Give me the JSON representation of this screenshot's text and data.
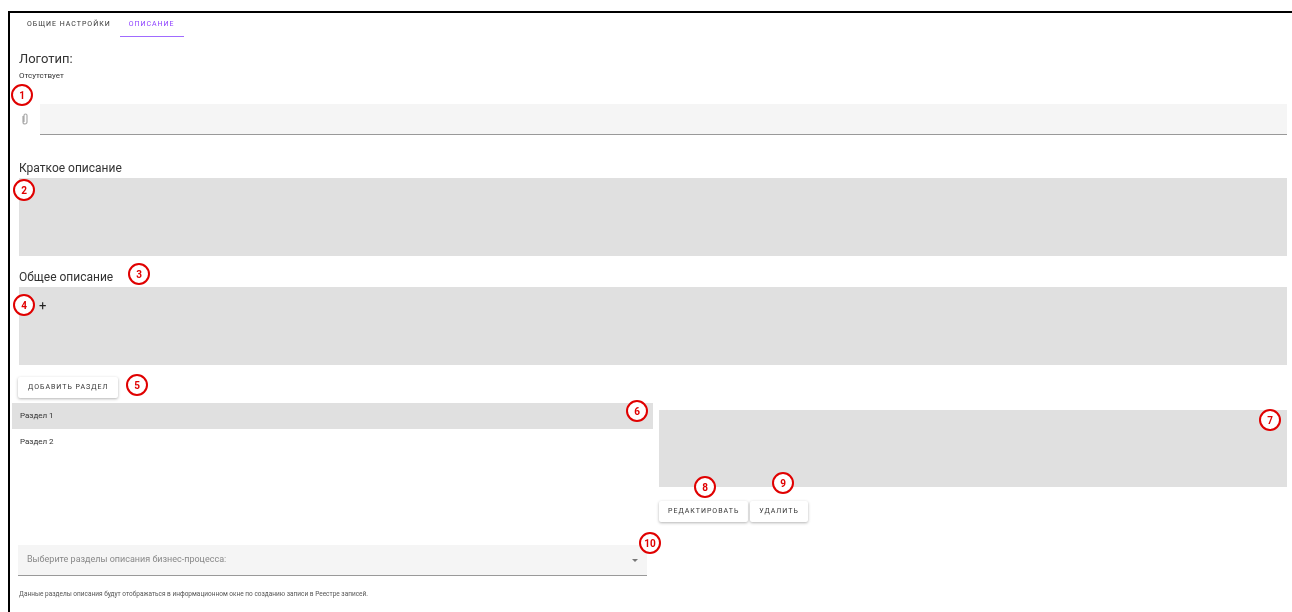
{
  "tabs": [
    {
      "label": "ОБЩИЕ НАСТРОЙКИ",
      "selected": false
    },
    {
      "label": "ОПИСАНИЕ",
      "selected": true
    }
  ],
  "logo": {
    "label": "Логотип:",
    "status": "Отсутствует"
  },
  "short_description": {
    "label": "Краткое описание"
  },
  "general_description": {
    "label": "Общее описание",
    "add_symbol": "+"
  },
  "add_section_button": "ДОБАВИТЬ РАЗДЕЛ",
  "sections": [
    {
      "label": "Раздел 1",
      "selected": true
    },
    {
      "label": "Раздел 2",
      "selected": false
    }
  ],
  "section_buttons": [
    "РЕДАКТИРОВАТЬ",
    "УДАЛИТЬ"
  ],
  "select": {
    "placeholder": "Выберите разделы описания бизнес-процесса:"
  },
  "hint": "Данные разделы описания будут отображаться в информационном окне по созданию записи в Реестре записей.",
  "callouts": [
    "1",
    "2",
    "3",
    "4",
    "5",
    "6",
    "7",
    "8",
    "9",
    "10"
  ]
}
